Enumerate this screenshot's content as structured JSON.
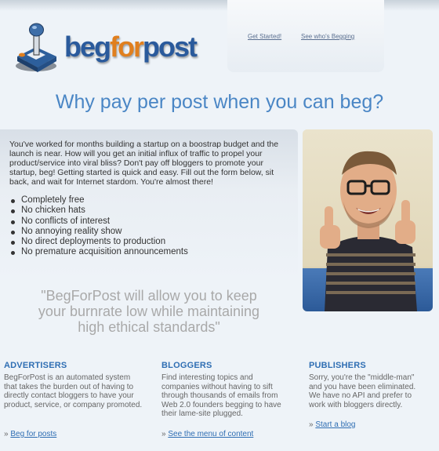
{
  "logo": {
    "part1": "beg",
    "part2": "for",
    "part3": "post"
  },
  "nav": {
    "get_started": "Get Started!",
    "see_begging": "See who's Begging"
  },
  "headline": "Why pay per post when you can beg?",
  "intro": {
    "paragraph": "You've worked for months building a startup on a boostrap budget and the launch is near. How will you get an initial influx of traffic to propel your product/service into viral bliss? Don't pay off bloggers to promote your startup, beg! Getting started is quick and easy. Fill out the form below, sit back, and wait for Internet stardom. You're almost there!",
    "bullets": [
      "Completely free",
      "No chicken hats",
      "No conflicts of interest",
      "No annoying reality show",
      "No direct deployments to production",
      "No premature acquisition announcements"
    ]
  },
  "quote": "\"BegForPost will allow you to keep your burnrate low while maintaining high ethical standards\"",
  "columns": {
    "advertisers": {
      "heading": "ADVERTISERS",
      "text": "BegForPost is an automated system that takes the burden out of having to directly contact bloggers to have your product, service, or company promoted.",
      "link": "Beg for posts"
    },
    "bloggers": {
      "heading": "BLOGGERS",
      "text": "Find interesting topics and companies without having to sift through thousands of emails from Web 2.0 founders begging to have their lame-site plugged.",
      "link": "See the menu of content"
    },
    "publishers": {
      "heading": "PUBLISHERS",
      "text": "Sorry, you're the \"middle-man\" and you have been eliminated. We have no API and prefer to work with bloggers directly.",
      "link": "Start a blog"
    }
  },
  "link_prefix": "»"
}
